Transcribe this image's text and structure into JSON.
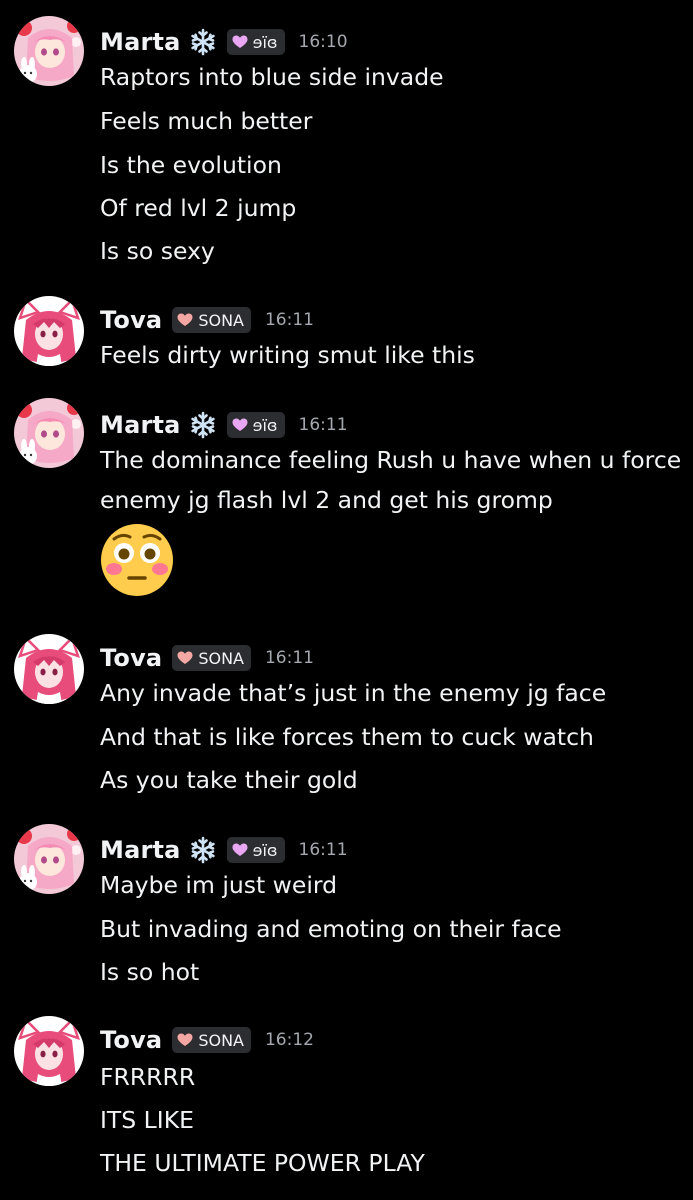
{
  "messages": [
    {
      "author": "Marta",
      "tag": "ɘïɞ",
      "time": "16:10",
      "lines": [
        "Raptors into blue side invade",
        "Feels much better",
        "Is the evolution",
        "Of red lvl 2 jump",
        "Is so sexy"
      ]
    },
    {
      "author": "Tova",
      "tag": "SONA",
      "time": "16:11",
      "lines": [
        "Feels dirty writing smut like this"
      ]
    },
    {
      "author": "Marta",
      "tag": "ɘïɞ",
      "time": "16:11",
      "lines": [
        "The dominance feeling Rush u have when u force",
        "enemy jg flash lvl 2 and get his gromp"
      ],
      "emoji": "flushed-face"
    },
    {
      "author": "Tova",
      "tag": "SONA",
      "time": "16:11",
      "lines": [
        "Any invade that’s just in the enemy jg face",
        "And that is like forces them to cuck watch",
        "As you take their gold"
      ]
    },
    {
      "author": "Marta",
      "tag": "ɘïɞ",
      "time": "16:11",
      "lines": [
        "Maybe im just weird",
        "But invading and emoting on their face",
        "Is so hot"
      ]
    },
    {
      "author": "Tova",
      "tag": "SONA",
      "time": "16:12",
      "lines": [
        "FRRRRR",
        "ITS LIKE",
        "THE ULTIMATE POWER PLAY"
      ]
    }
  ],
  "colors": {
    "background": "#000000",
    "text": "#f2f3f5",
    "timestamp": "#a5a8ae",
    "tag_background": "#2b2d31",
    "marta_tag_heart": "#e9a6f2",
    "tova_tag_heart": "#f4a7a3"
  }
}
